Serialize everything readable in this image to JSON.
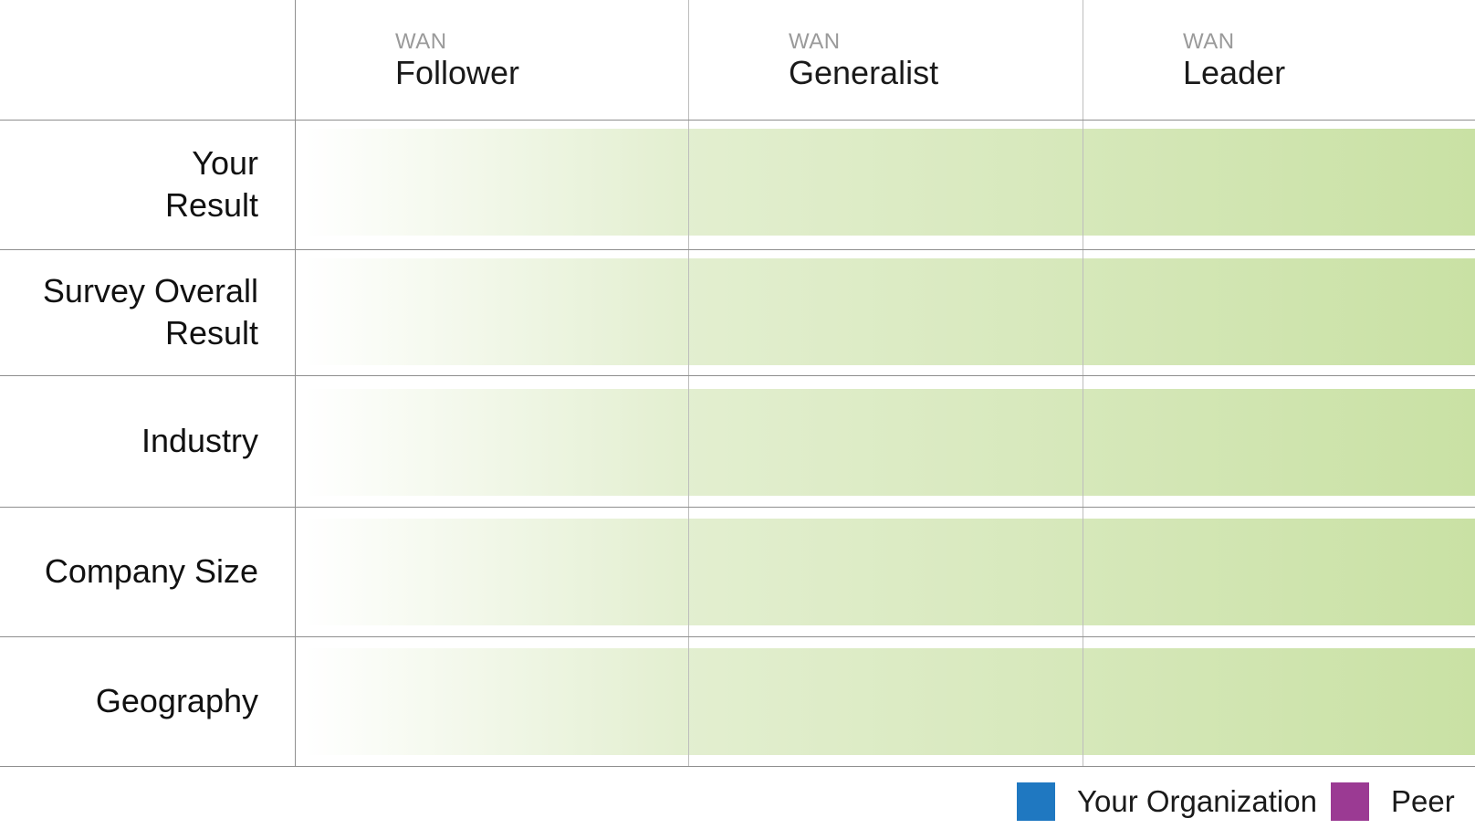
{
  "columns": [
    {
      "prefix": "WAN",
      "title": "Follower"
    },
    {
      "prefix": "WAN",
      "title": "Generalist"
    },
    {
      "prefix": "WAN",
      "title": "Leader"
    }
  ],
  "rows": [
    {
      "label_line1": "Your",
      "label_line2": "Result"
    },
    {
      "label_line1": "Survey Overall",
      "label_line2": "Result"
    },
    {
      "label_line1": "Industry",
      "label_line2": ""
    },
    {
      "label_line1": "Company Size",
      "label_line2": ""
    },
    {
      "label_line1": "Geography",
      "label_line2": ""
    }
  ],
  "legend": [
    {
      "label": "Your Organization",
      "color": "#1f78c1"
    },
    {
      "label": "Peer",
      "color": "#9b3a93"
    }
  ],
  "colors": {
    "band_start": "#ffffff",
    "band_end": "#c9e1a4",
    "grid_line": "#8f8f8f"
  }
}
